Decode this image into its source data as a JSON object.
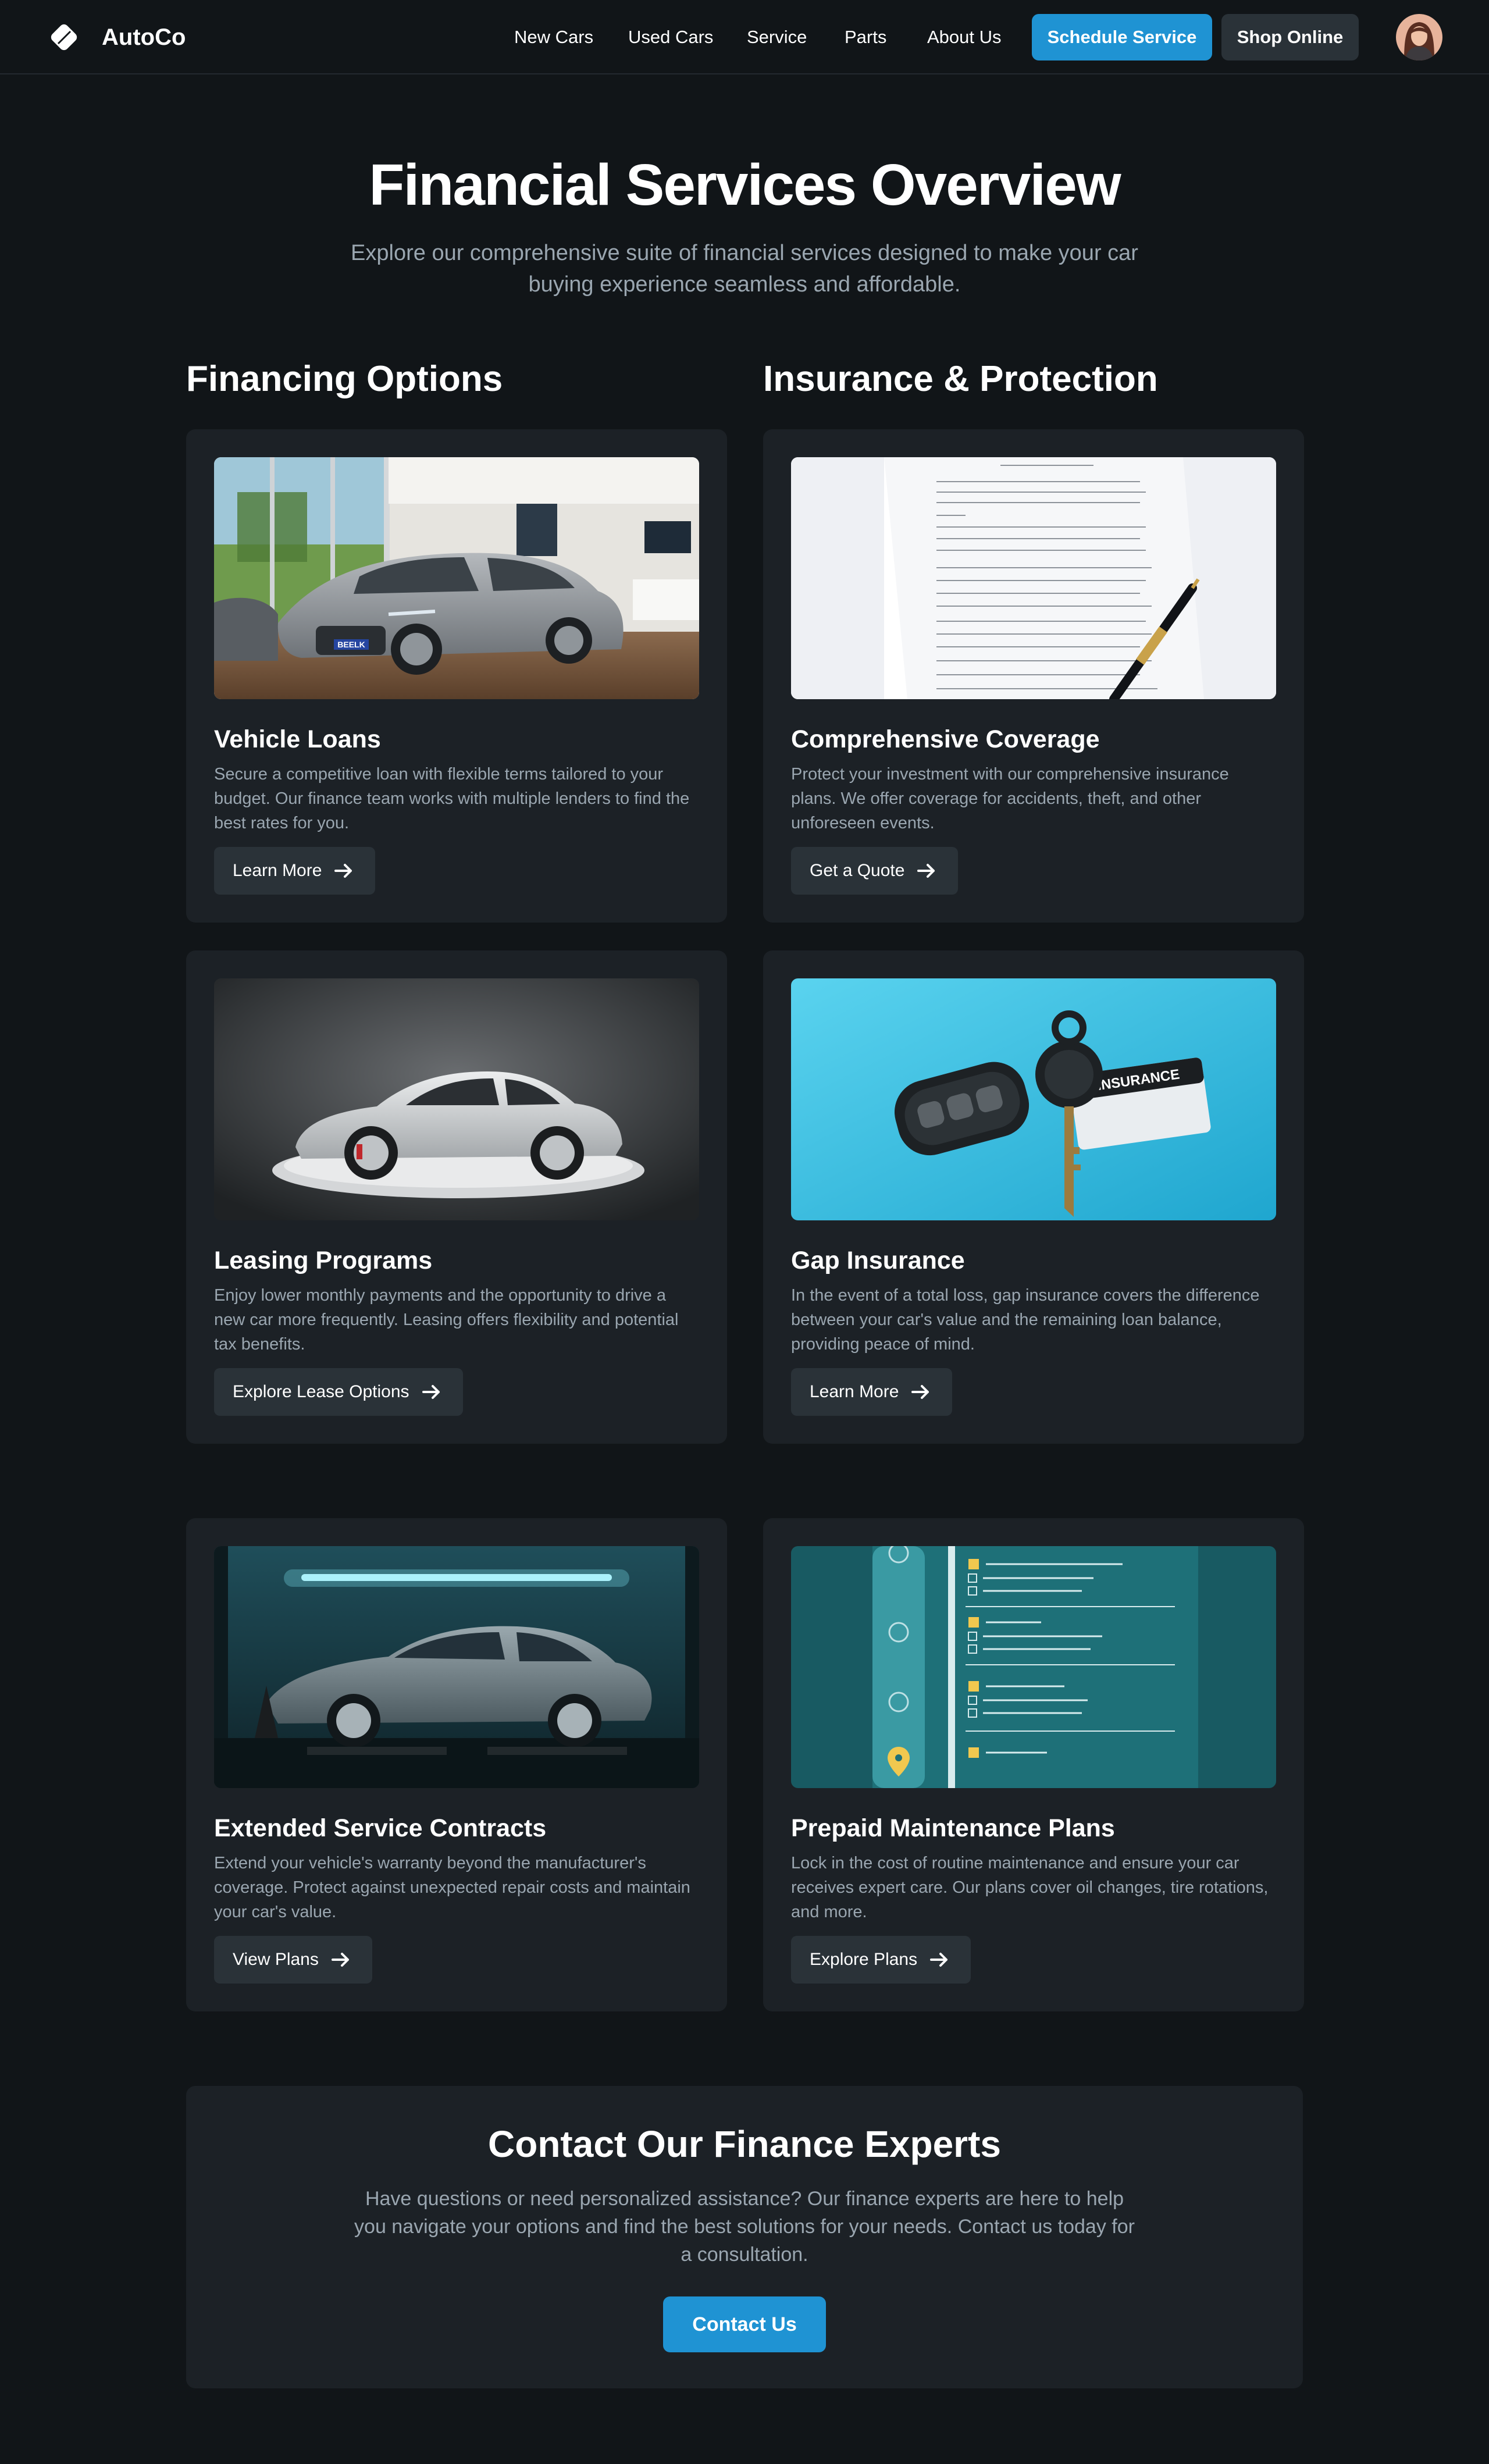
{
  "header": {
    "brand": "AutoCo",
    "nav": [
      "New Cars",
      "Used Cars",
      "Service",
      "Parts",
      "About Us"
    ],
    "schedule_label": "Schedule Service",
    "shop_label": "Shop Online"
  },
  "hero": {
    "title": "Financial Services Overview",
    "subtitle": "Explore our comprehensive suite of financial services designed to make your car buying experience seamless and affordable."
  },
  "sections": {
    "financing": "Financing Options",
    "insurance": "Insurance & Protection"
  },
  "cards": [
    {
      "title": "Vehicle Loans",
      "description": "Secure a competitive loan with flexible terms tailored to your budget. Our finance team works with multiple lenders to find the best rates for you.",
      "button": "Learn More",
      "image": "sedan-in-showroom"
    },
    {
      "title": "Comprehensive Coverage",
      "description": "Protect your investment with our comprehensive insurance plans. We offer coverage for accidents, theft, and other unforeseen events.",
      "button": "Get a Quote",
      "image": "insurance-document-with-pen"
    },
    {
      "title": "Leasing Programs",
      "description": "Enjoy lower monthly payments and the opportunity to drive a new car more frequently. Leasing offers flexibility and potential tax benefits.",
      "button": "Explore Lease Options",
      "image": "silver-coupe-on-platform"
    },
    {
      "title": "Gap Insurance",
      "description": "In the event of a total loss, gap insurance covers the difference between your car's value and the remaining loan balance, providing peace of mind.",
      "button": "Learn More",
      "image": "car-keys-and-insurance-card",
      "image_text": "INSURANCE"
    },
    {
      "title": "Extended Service Contracts",
      "description": "Extend your vehicle's warranty beyond the manufacturer's coverage. Protect against unexpected repair costs and maintain your car's value.",
      "button": "View Plans",
      "image": "sedan-on-service-lift"
    },
    {
      "title": "Prepaid Maintenance Plans",
      "description": "Lock in the cost of routine maintenance and ensure your car receives expert care. Our plans cover oil changes, tire rotations, and more.",
      "button": "Explore Plans",
      "image": "maintenance-checklist"
    }
  ],
  "contact": {
    "title": "Contact Our Finance Experts",
    "text": "Have questions or need personalized assistance? Our finance experts are here to help you navigate your options and find the best solutions for your needs. Contact us today for a consultation.",
    "button": "Contact Us"
  },
  "colors": {
    "background": "#111518",
    "card": "#1c2126",
    "accent": "#1f93d3",
    "muted_text": "#9aa6b0"
  }
}
